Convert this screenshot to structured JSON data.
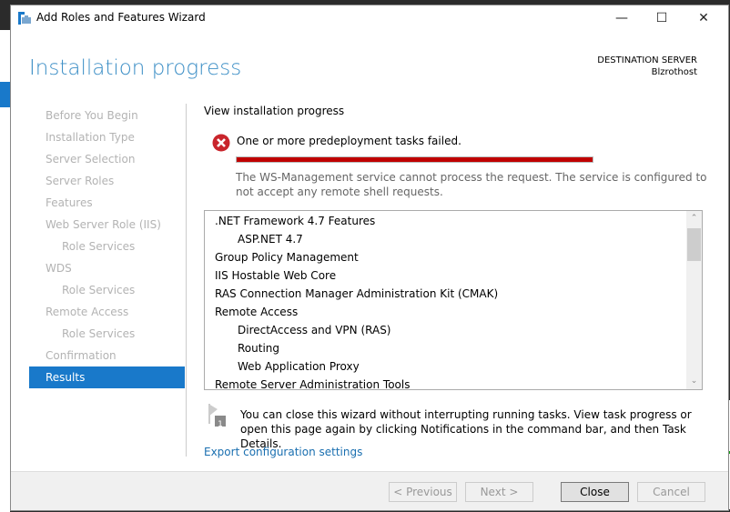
{
  "window": {
    "title": "Add Roles and Features Wizard"
  },
  "header": {
    "title": "Installation progress",
    "destination_label": "DESTINATION SERVER",
    "destination_server": "Blzrothost"
  },
  "nav": {
    "items": [
      {
        "label": "Before You Begin",
        "level": 0
      },
      {
        "label": "Installation Type",
        "level": 0
      },
      {
        "label": "Server Selection",
        "level": 0
      },
      {
        "label": "Server Roles",
        "level": 0
      },
      {
        "label": "Features",
        "level": 0
      },
      {
        "label": "Web Server Role (IIS)",
        "level": 0
      },
      {
        "label": "Role Services",
        "level": 1
      },
      {
        "label": "WDS",
        "level": 0
      },
      {
        "label": "Role Services",
        "level": 1
      },
      {
        "label": "Remote Access",
        "level": 0
      },
      {
        "label": "Role Services",
        "level": 1
      },
      {
        "label": "Confirmation",
        "level": 0
      },
      {
        "label": "Results",
        "level": 0,
        "active": true
      }
    ]
  },
  "main": {
    "section_label": "View installation progress",
    "error_message": "One or more predeployment tasks failed.",
    "progress_percent": 100,
    "progress_color": "#c00000",
    "error_detail": "The WS-Management service cannot process the request. The service is configured to not accept any remote shell requests.",
    "features": [
      {
        "label": ".NET Framework 4.7 Features",
        "level": 0
      },
      {
        "label": "ASP.NET 4.7",
        "level": 1
      },
      {
        "label": "Group Policy Management",
        "level": 0
      },
      {
        "label": "IIS Hostable Web Core",
        "level": 0
      },
      {
        "label": "RAS Connection Manager Administration Kit (CMAK)",
        "level": 0
      },
      {
        "label": "Remote Access",
        "level": 0
      },
      {
        "label": "DirectAccess and VPN (RAS)",
        "level": 1
      },
      {
        "label": "Routing",
        "level": 1
      },
      {
        "label": "Web Application Proxy",
        "level": 1
      },
      {
        "label": "Remote Server Administration Tools",
        "level": 0
      }
    ],
    "note": "You can close this wizard without interrupting running tasks. View task progress or open this page again by clicking Notifications in the command bar, and then Task Details.",
    "notification_badge": "1",
    "export_link": "Export configuration settings"
  },
  "footer": {
    "previous": "< Previous",
    "next": "Next >",
    "close": "Close",
    "cancel": "Cancel"
  }
}
